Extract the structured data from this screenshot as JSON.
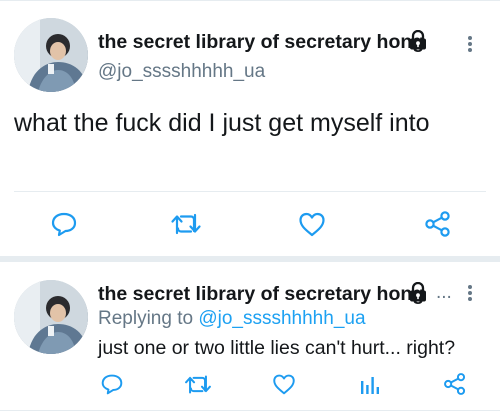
{
  "tweet1": {
    "display_name": "the secret library of secretary hong",
    "handle": "@jo_sssshhhhh_ua",
    "text": "what the fuck did I just get myself into",
    "icons": [
      "lock-icon",
      "more-icon",
      "reply-icon",
      "retweet-icon",
      "like-icon",
      "share-icon"
    ]
  },
  "tweet2": {
    "display_name": "the secret library of secretary hong",
    "ellipsis": "...",
    "replying_prefix": "Replying to",
    "replying_handle": "@jo_sssshhhhh_ua",
    "text": "just one or two little lies can't hurt... right?",
    "icons": [
      "lock-icon",
      "more-icon",
      "reply-icon",
      "retweet-icon",
      "like-icon",
      "analytics-icon",
      "share-icon"
    ]
  },
  "colors": {
    "text": "#14171a",
    "secondary": "#657786",
    "link": "#1da1f2",
    "icon": "#1d9bf0",
    "divider": "#e6ecf0"
  }
}
